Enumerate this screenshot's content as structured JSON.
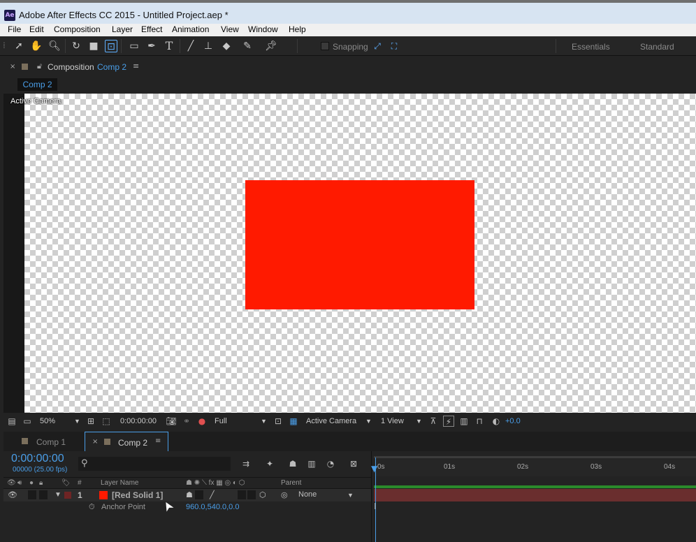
{
  "window": {
    "app_icon": "Ae",
    "title": "Adobe After Effects CC 2015 - Untitled Project.aep *"
  },
  "menubar": [
    "File",
    "Edit",
    "Composition",
    "Layer",
    "Effect",
    "Animation",
    "View",
    "Window",
    "Help"
  ],
  "toolbar": {
    "snapping_label": "Snapping",
    "workspaces": [
      "Essentials",
      "Standard"
    ]
  },
  "composition_panel": {
    "close": "×",
    "title_prefix": "Composition",
    "comp_name": "Comp 2",
    "menu": "≡",
    "subtab": "Comp 2",
    "overlay_label": "Active Camera",
    "solid_color": "#ff1a00"
  },
  "viewer_controls": {
    "zoom": "50%",
    "timecode": "0:00:00:00",
    "resolution": "Full",
    "camera": "Active Camera",
    "views": "1 View",
    "exposure": "+0.0"
  },
  "timeline": {
    "tabs": [
      {
        "label": "Comp 1",
        "active": false
      },
      {
        "label": "Comp 2",
        "active": true
      }
    ],
    "current_time": "0:00:00:00",
    "fps_info": "00000 (25.00 fps)",
    "column_headers": {
      "number": "#",
      "layer_name": "Layer Name",
      "parent": "Parent"
    },
    "layer": {
      "number": "1",
      "name": "[Red Solid 1]",
      "parent": "None",
      "color": "#ff1a00"
    },
    "property": {
      "name": "Anchor Point",
      "value": "960.0,540.0,0.0"
    },
    "ruler_ticks": [
      "0s",
      "01s",
      "02s",
      "03s",
      "04s"
    ]
  }
}
